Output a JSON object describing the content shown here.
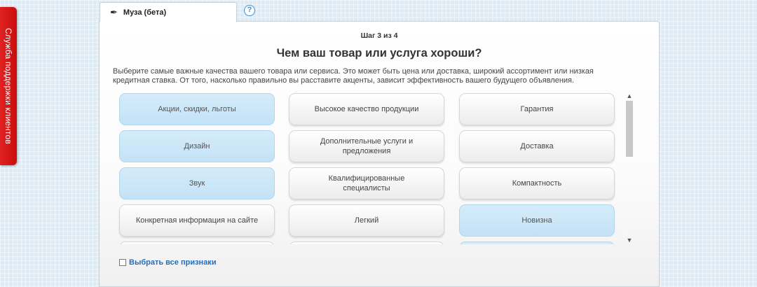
{
  "support": {
    "label": "Служба поддержки клиентов"
  },
  "tabs": {
    "active_label": "Муза (бета)",
    "help_symbol": "?"
  },
  "header": {
    "step": "Шаг 3 из 4",
    "title": "Чем ваш товар или услуга хороши?",
    "description": "Выберите самые важные качества вашего товара или сервиса. Это может быть цена или доставка, широкий ассортимент или низкая кредитная ставка. От того, насколько правильно вы расставите акценты, зависит эффективность вашего будущего объявления."
  },
  "options": [
    {
      "label": "Акции, скидки, льготы",
      "selected": true
    },
    {
      "label": "Высокое качество продукции",
      "selected": false
    },
    {
      "label": "Гарантия",
      "selected": false
    },
    {
      "label": "Дизайн",
      "selected": true
    },
    {
      "label": "Дополнительные услуги и предложения",
      "selected": false
    },
    {
      "label": "Доставка",
      "selected": false
    },
    {
      "label": "Звук",
      "selected": true
    },
    {
      "label": "Квалифицированные специалисты",
      "selected": false
    },
    {
      "label": "Компактность",
      "selected": false
    },
    {
      "label": "Конкретная информация на сайте",
      "selected": false
    },
    {
      "label": "Легкий",
      "selected": false
    },
    {
      "label": "Новизна",
      "selected": true
    }
  ],
  "select_all": {
    "label": "Выбрать все признаки",
    "checked": false
  },
  "colors": {
    "accent": "#1f6fbf",
    "selected_bg": "#cfe8f8",
    "support_red": "#d91414"
  }
}
